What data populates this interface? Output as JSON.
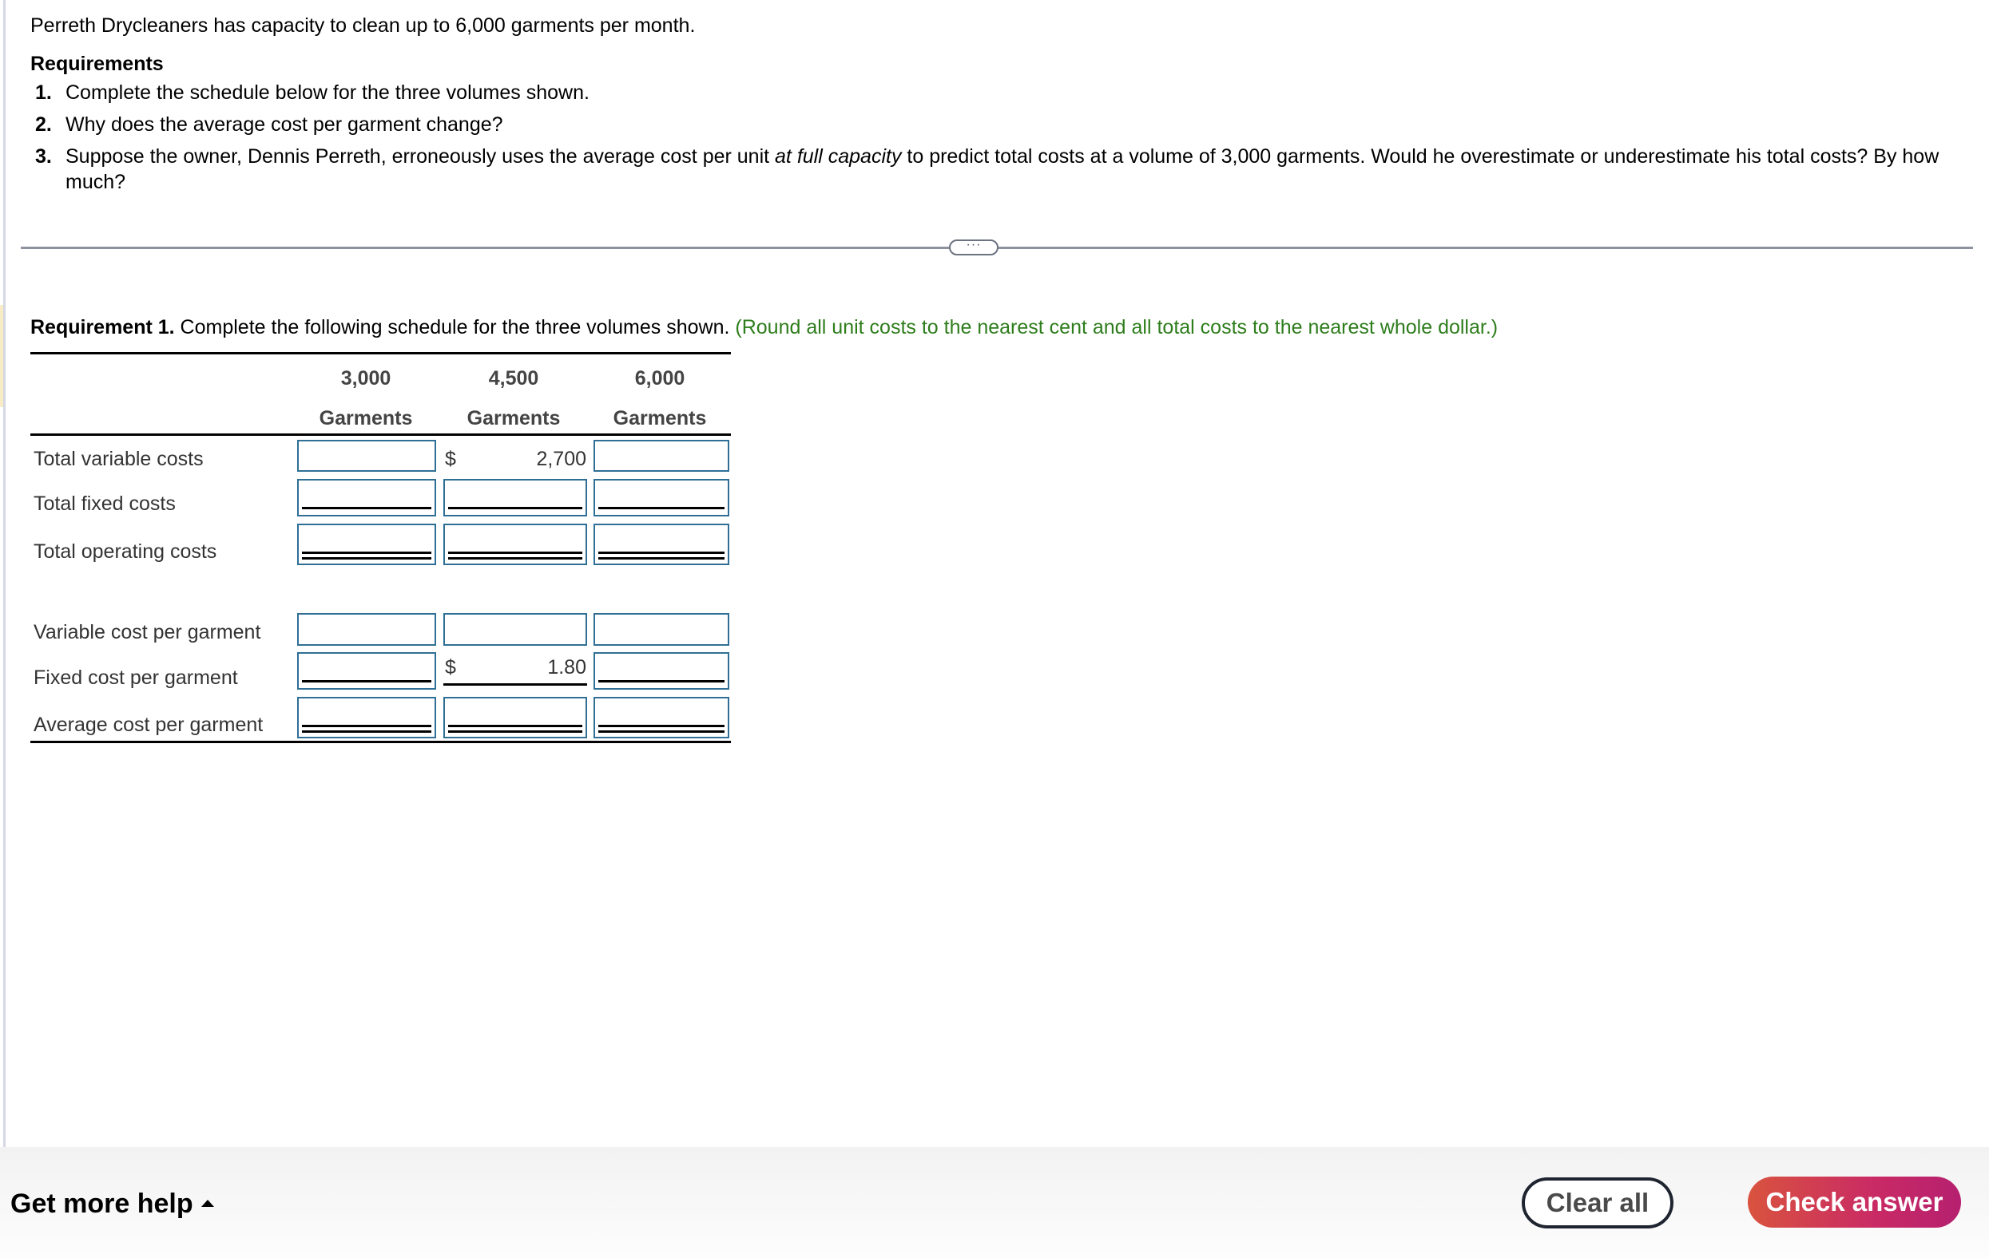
{
  "problem": {
    "intro": "Perreth Drycleaners has capacity to clean up to 6,000 garments per month.",
    "requirements_title": "Requirements",
    "requirements": [
      {
        "num": "1.",
        "text": "Complete the schedule below for the three volumes shown."
      },
      {
        "num": "2.",
        "text": "Why does the average cost per garment change?"
      },
      {
        "num": "3.",
        "text_before": "Suppose the owner, Dennis Perreth, erroneously uses the average cost per unit ",
        "text_italic": "at full capacity",
        "text_after": " to predict total costs at a volume of 3,000 garments. Would he overestimate or underestimate his total costs? By how much?"
      }
    ]
  },
  "divider_button": {
    "label": "···",
    "icon": "ellipsis-icon"
  },
  "requirement1": {
    "bold": "Requirement 1.",
    "text": " Complete the following schedule for the three volumes shown. ",
    "hint": "(Round all unit costs to the nearest cent and all total costs to the nearest whole dollar.)",
    "hint_color": "#2e7d1c"
  },
  "schedule": {
    "columns": [
      {
        "volume": "3,000",
        "unit": "Garments"
      },
      {
        "volume": "4,500",
        "unit": "Garments"
      },
      {
        "volume": "6,000",
        "unit": "Garments"
      }
    ],
    "rows": [
      {
        "label": "Total variable costs",
        "cells": [
          "",
          "2,700",
          ""
        ],
        "given": [
          false,
          true,
          false
        ],
        "currency": [
          false,
          true,
          false
        ],
        "underline": "none"
      },
      {
        "label": "Total fixed costs",
        "cells": [
          "",
          "",
          ""
        ],
        "given": [
          false,
          false,
          false
        ],
        "currency": [
          false,
          false,
          false
        ],
        "underline": "single"
      },
      {
        "label": "Total operating costs",
        "cells": [
          "",
          "",
          ""
        ],
        "given": [
          false,
          false,
          false
        ],
        "currency": [
          false,
          false,
          false
        ],
        "underline": "double"
      },
      {
        "label": "Variable cost per garment",
        "cells": [
          "",
          "",
          ""
        ],
        "given": [
          false,
          false,
          false
        ],
        "currency": [
          false,
          false,
          false
        ],
        "underline": "none"
      },
      {
        "label": "Fixed cost per garment",
        "cells": [
          "",
          "1.80",
          ""
        ],
        "given": [
          false,
          true,
          false
        ],
        "currency": [
          false,
          true,
          false
        ],
        "underline": "single"
      },
      {
        "label": "Average cost per garment",
        "cells": [
          "",
          "",
          ""
        ],
        "given": [
          false,
          false,
          false
        ],
        "currency": [
          false,
          false,
          false
        ],
        "underline": "double"
      }
    ],
    "currency_symbol": "$",
    "input_border_color": "#2f6f95"
  },
  "footer": {
    "help_label": "Get more help",
    "help_icon": "caret-up-icon",
    "clear_label": "Clear all",
    "check_label": "Check answer",
    "check_gradient": [
      "#d9533e",
      "#c92a65",
      "#b5206f"
    ]
  }
}
